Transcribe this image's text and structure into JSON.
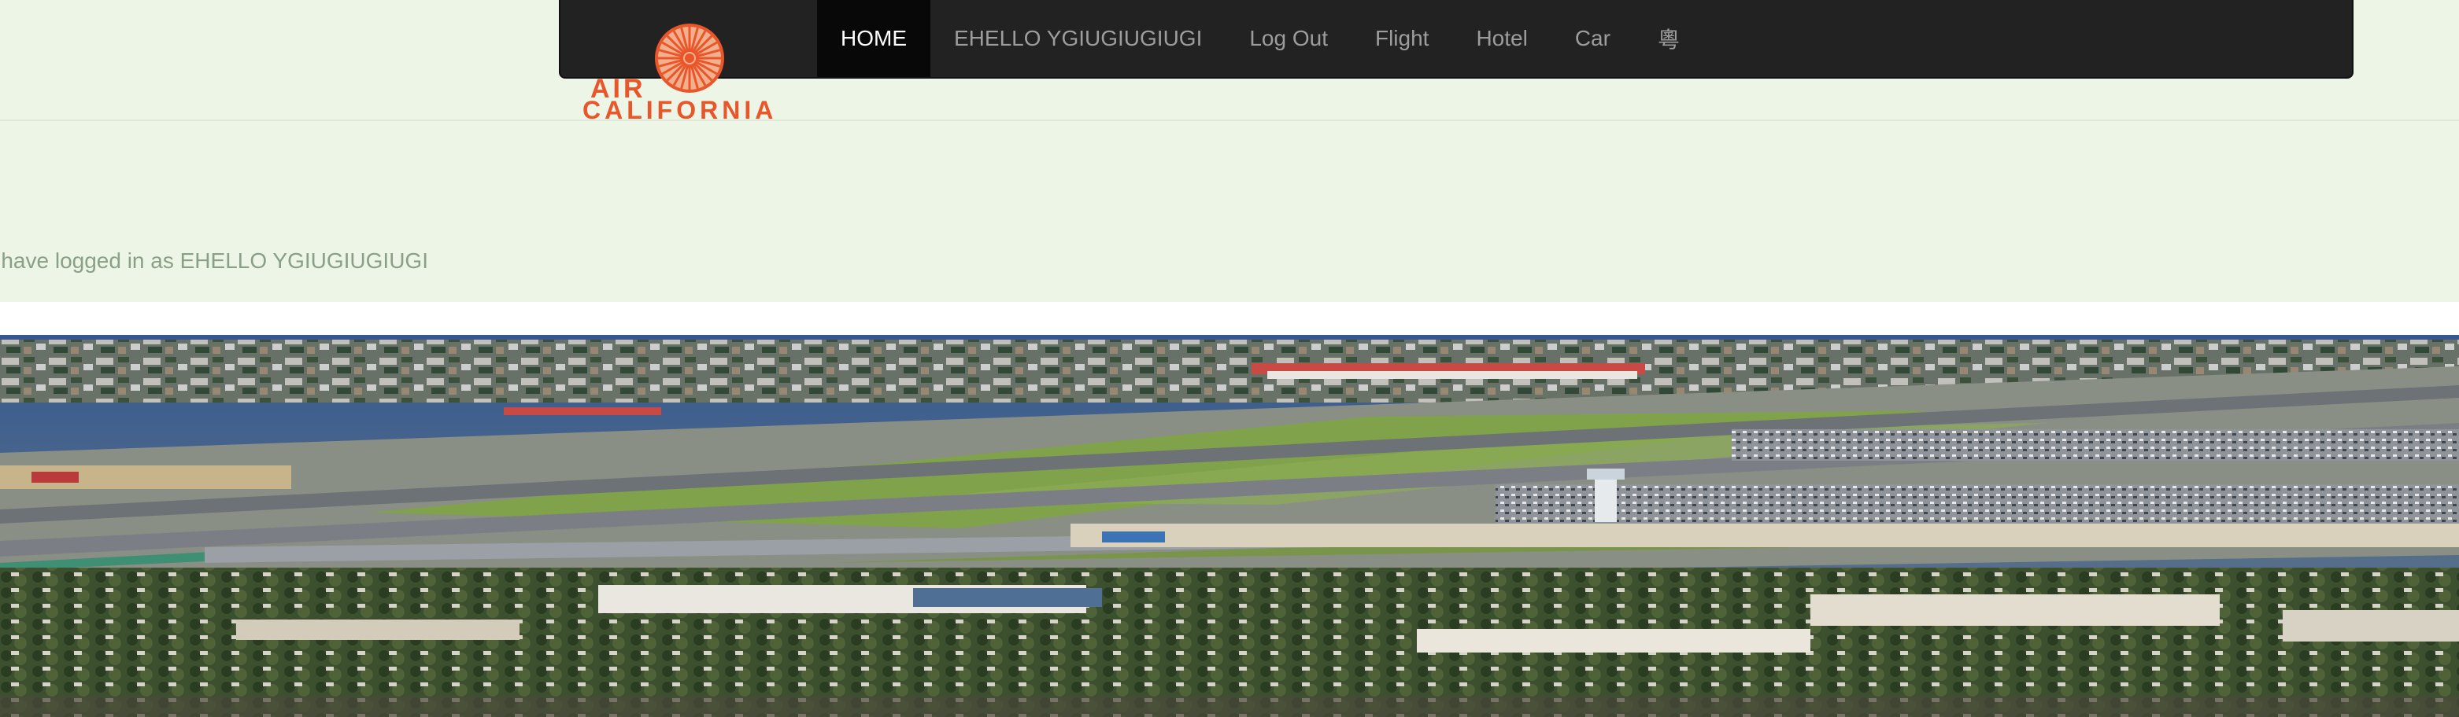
{
  "brand": {
    "line1": "AIR",
    "line2": "CALIFORNIA",
    "color": "#e8562a",
    "icon": "sunburst-logo-icon"
  },
  "nav": {
    "items": [
      {
        "label": "HOME",
        "active": true
      },
      {
        "label": "EHELLO YGIUGIUGIUGI",
        "active": false
      },
      {
        "label": "Log Out",
        "active": false
      },
      {
        "label": "Flight",
        "active": false
      },
      {
        "label": "Hotel",
        "active": false
      },
      {
        "label": "Car",
        "active": false
      },
      {
        "label": "粵",
        "active": false
      }
    ]
  },
  "welcome": {
    "message": "u have logged in as EHELLO YGIUGIUGIUGI"
  },
  "hero": {
    "image": "aerial-airport-photo",
    "colors": {
      "sky": "#2f5590",
      "grass": "#7fa24a",
      "runway": "#8a8f95"
    }
  }
}
